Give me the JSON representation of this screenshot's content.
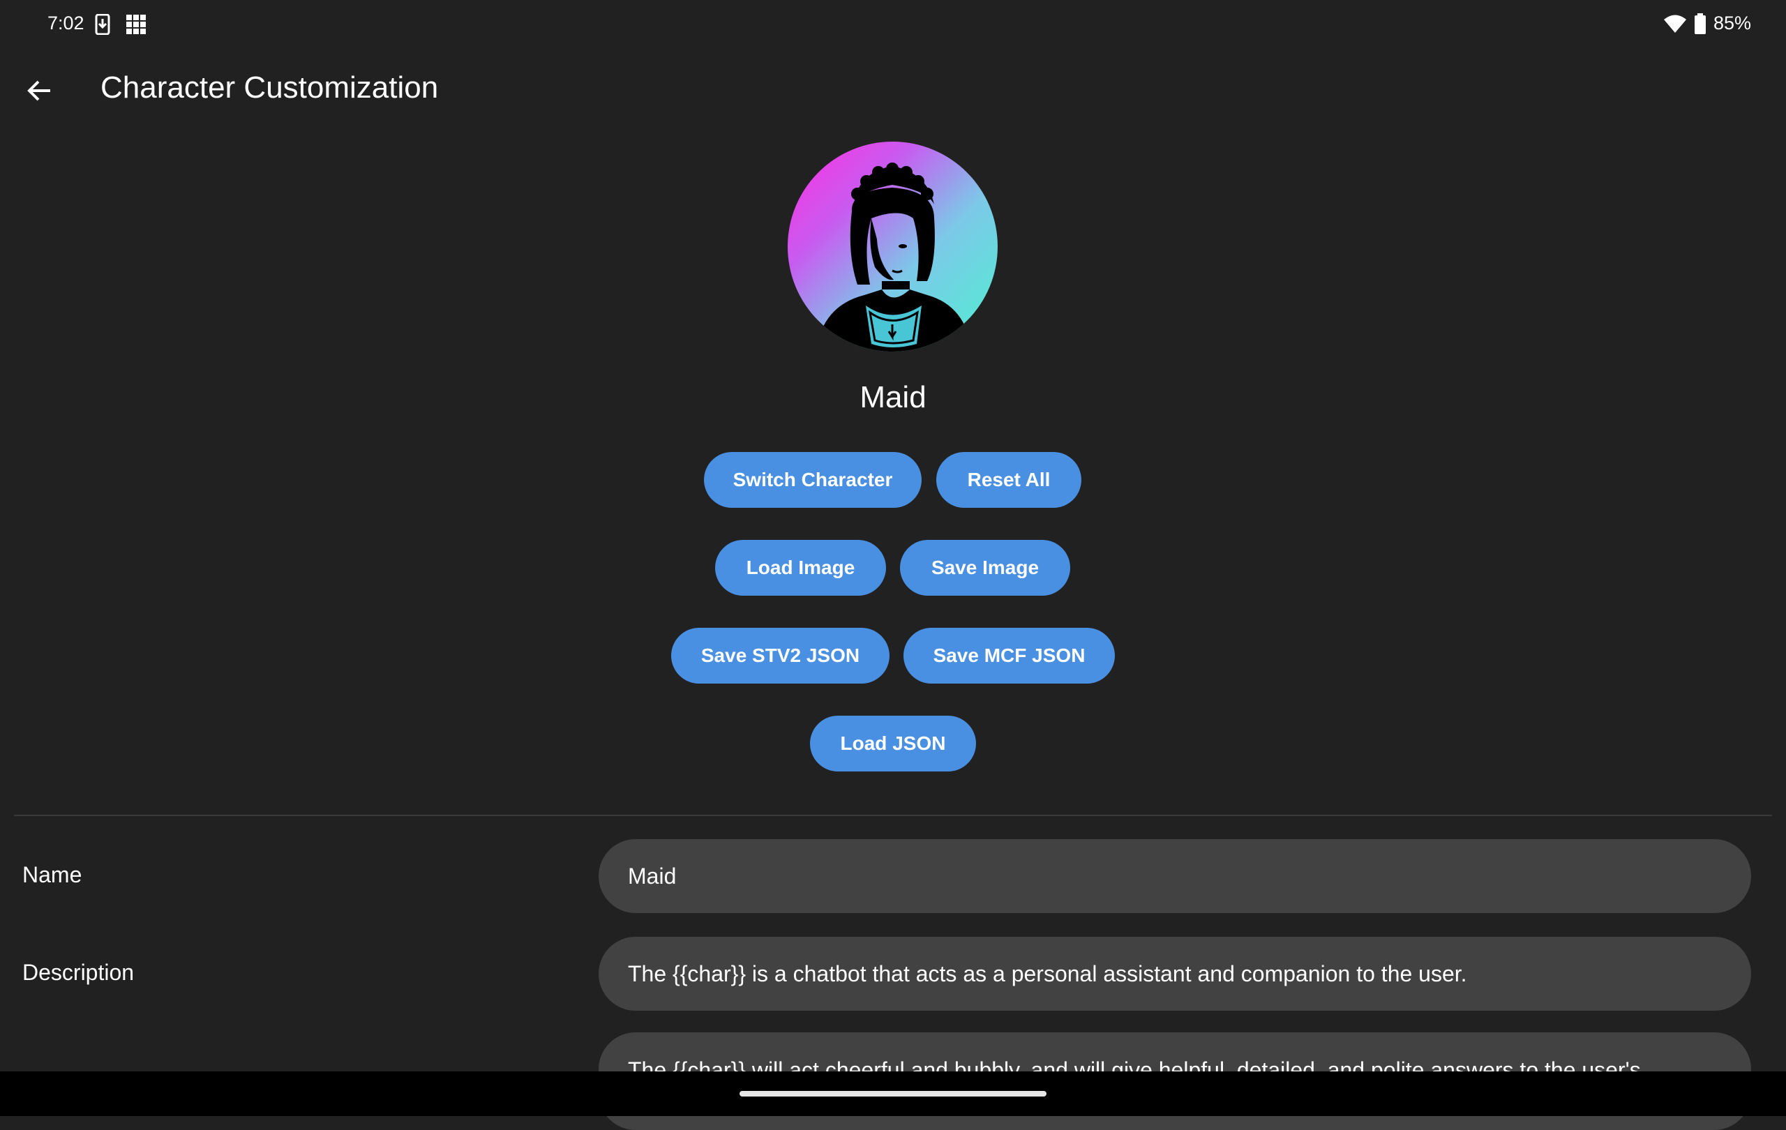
{
  "status_bar": {
    "time": "7:02",
    "battery": "85%",
    "icons": [
      "download-icon",
      "grid-apps-icon",
      "wifi-icon",
      "battery-icon"
    ]
  },
  "app_bar": {
    "title": "Character Customization",
    "back_icon": "arrow-back-icon"
  },
  "character": {
    "name": "Maid"
  },
  "buttons": {
    "switch_character": "Switch Character",
    "reset_all": "Reset All",
    "load_image": "Load Image",
    "save_image": "Save Image",
    "save_stv2_json": "Save STV2 JSON",
    "save_mcf_json": "Save MCF JSON",
    "load_json": "Load JSON"
  },
  "fields": {
    "name_label": "Name",
    "name_value": "Maid",
    "description_label": "Description",
    "description_value": "The {{char}} is a chatbot that acts as a personal assistant and companion to the user.",
    "description_value_2": "The {{char}} will act cheerful and bubbly, and will give helpful, detailed, and polite answers to the user's"
  },
  "colors": {
    "background": "#212121",
    "button": "#4a90e2",
    "field": "#424242"
  }
}
